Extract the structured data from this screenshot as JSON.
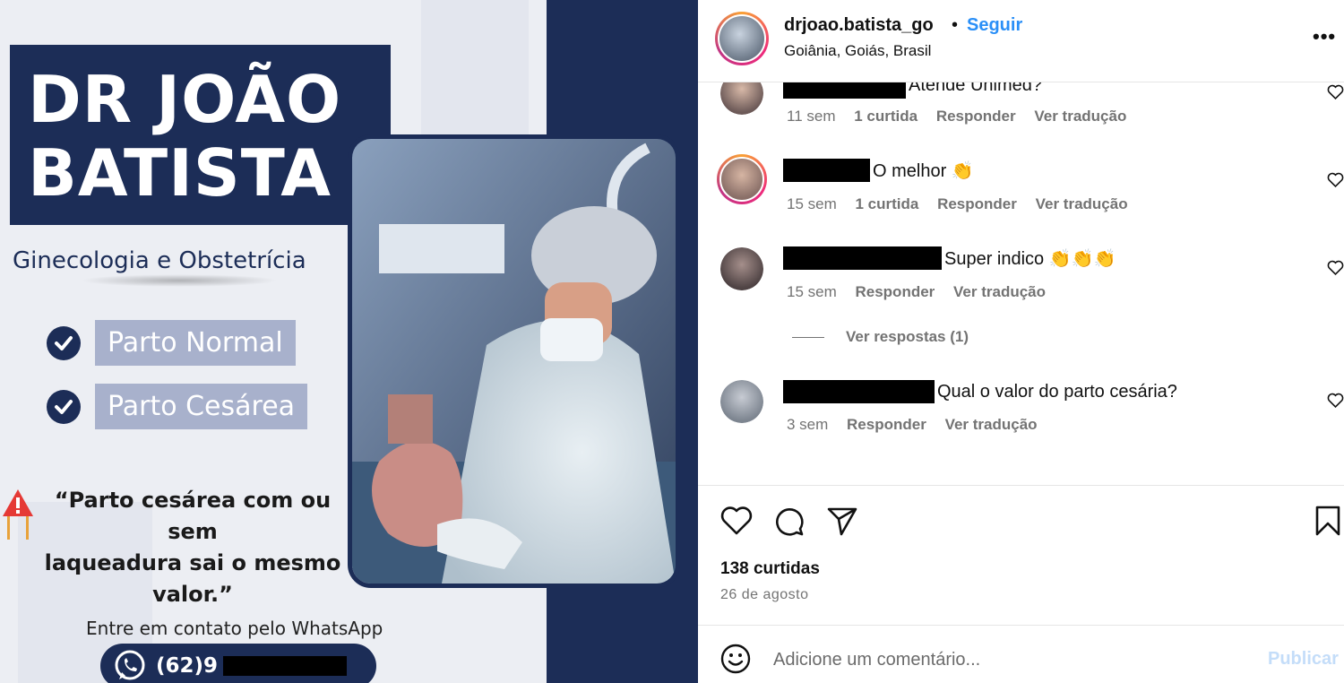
{
  "post_image": {
    "title_line1": "DR JOÃO",
    "title_line2": "BATISTA",
    "specialty": "Ginecologia e Obstetrícia",
    "services": [
      "Parto Normal",
      "Parto Cesárea"
    ],
    "quote_line1": "“Parto cesárea com ou sem",
    "quote_line2": "laqueadura sai o mesmo",
    "quote_line3": "valor.”",
    "contact_text": "Entre em contato pelo WhatsApp",
    "phone_prefix": "(62)9"
  },
  "header": {
    "username": "drjoao.batista_go",
    "separator": "•",
    "follow_label": "Seguir",
    "location": "Goiânia, Goiás, Brasil",
    "more_label": "•••"
  },
  "comments": [
    {
      "text": "Atende Unimed?",
      "time": "11 sem",
      "likes": "1 curtida",
      "reply": "Responder",
      "translate": "Ver tradução"
    },
    {
      "text": "O melhor 👏",
      "time": "15 sem",
      "likes": "1 curtida",
      "reply": "Responder",
      "translate": "Ver tradução"
    },
    {
      "text": "Super indico 👏👏👏",
      "time": "15 sem",
      "reply": "Responder",
      "translate": "Ver tradução"
    },
    {
      "text": "Qual o valor do parto cesária?",
      "time": "3 sem",
      "reply": "Responder",
      "translate": "Ver tradução"
    }
  ],
  "view_replies": "Ver respostas (1)",
  "post_footer": {
    "likes": "138 curtidas",
    "date": "26 de agosto",
    "comment_placeholder": "Adicione um comentário...",
    "publish_label": "Publicar"
  },
  "icons": [
    "heart-icon",
    "comment-icon",
    "share-icon",
    "bookmark-icon",
    "emoji-icon",
    "whatsapp-icon",
    "warning-icon",
    "check-icon"
  ],
  "colors": {
    "navy": "#1c2d57",
    "follow_blue": "#2a8ff7",
    "publish_disabled": "#c4ddf9",
    "muted_text": "#737373"
  }
}
